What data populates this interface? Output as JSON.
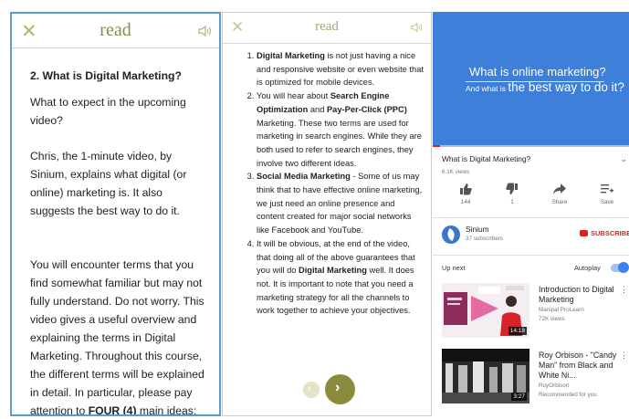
{
  "panel1": {
    "close_icon": "close-x",
    "title": "read",
    "speaker_icon": "speaker",
    "heading": "2. What is Digital Marketing?",
    "lines": [
      "What to expect in the upcoming video?",
      "Chris, the 1-minute video, by Sinium, explains what digital (or online) marketing is. It also suggests the best way to do it.",
      "You will encounter terms that you find somewhat familiar but may not fully understand. Do not worry. This video gives a useful overview and explaining the terms in Digital Marketing. Throughout this course, the different terms will be explained in detail. In particular, please pay attention to ",
      "FOUR (4)",
      " main ideas:"
    ]
  },
  "panel2": {
    "close_icon": "close-x",
    "title": "read",
    "speaker_icon": "speaker",
    "items": [
      {
        "b1": "Digital Marketing",
        "t1": " is not just having a nice and responsive website or even website that is optimized for mobile devices."
      },
      {
        "t0": "You will hear about ",
        "b1": "Search Engine Optimization",
        "t1": " and ",
        "b2": "Pay-Per-Click (PPC)",
        "t2": " Marketing. These two terms are used for marketing in search engines. While they are both used to refer to search engines, they involve two different ideas."
      },
      {
        "b1": "Social Media Marketing",
        "t1": " - Some of us may think that to have effective online marketing, we just need an online presence and content created for major social networks like Facebook and YouTube."
      },
      {
        "t0": "It will be obvious, at the end of the video, that doing all of the above guarantees that you will do ",
        "b1": "Digital Marketing",
        "t1": " well. It does not. It is important to note that you need a marketing strategy for all the channels to work together to achieve your objectives."
      }
    ],
    "prev_glyph": "‹",
    "next_glyph": "›"
  },
  "panel3": {
    "video_title_line1": "What is online marketing?",
    "video_title_line2_small": "And what is ",
    "video_title_line2_big": "the best way to do it?",
    "title": "What is Digital Marketing?",
    "views": "6.1K views",
    "actions": [
      {
        "icon": "thumbs-up-icon",
        "label": "144"
      },
      {
        "icon": "thumbs-down-icon",
        "label": "1"
      },
      {
        "icon": "share-icon",
        "label": "Share"
      },
      {
        "icon": "save-icon",
        "label": "Save"
      }
    ],
    "channel": "Sinium",
    "subscribers": "37 subscribers",
    "subscribe_label": "SUBSCRIBE",
    "up_next": "Up next",
    "autoplay": "Autoplay",
    "videos": [
      {
        "title": "Introduction to Digital Marketing",
        "channel": "Manipal ProLearn",
        "meta": "72K views",
        "duration": "14:18"
      },
      {
        "title": "Roy Orbison - \"Candy Man\" from Black and White Ni...",
        "channel": "RoyOrbison",
        "meta": "Recommended for you",
        "duration": "3:27"
      }
    ],
    "colors": {
      "video_bg": "#3d7fd9",
      "accent_red": "#e02020",
      "toggle_blue": "#3b82f0"
    }
  }
}
